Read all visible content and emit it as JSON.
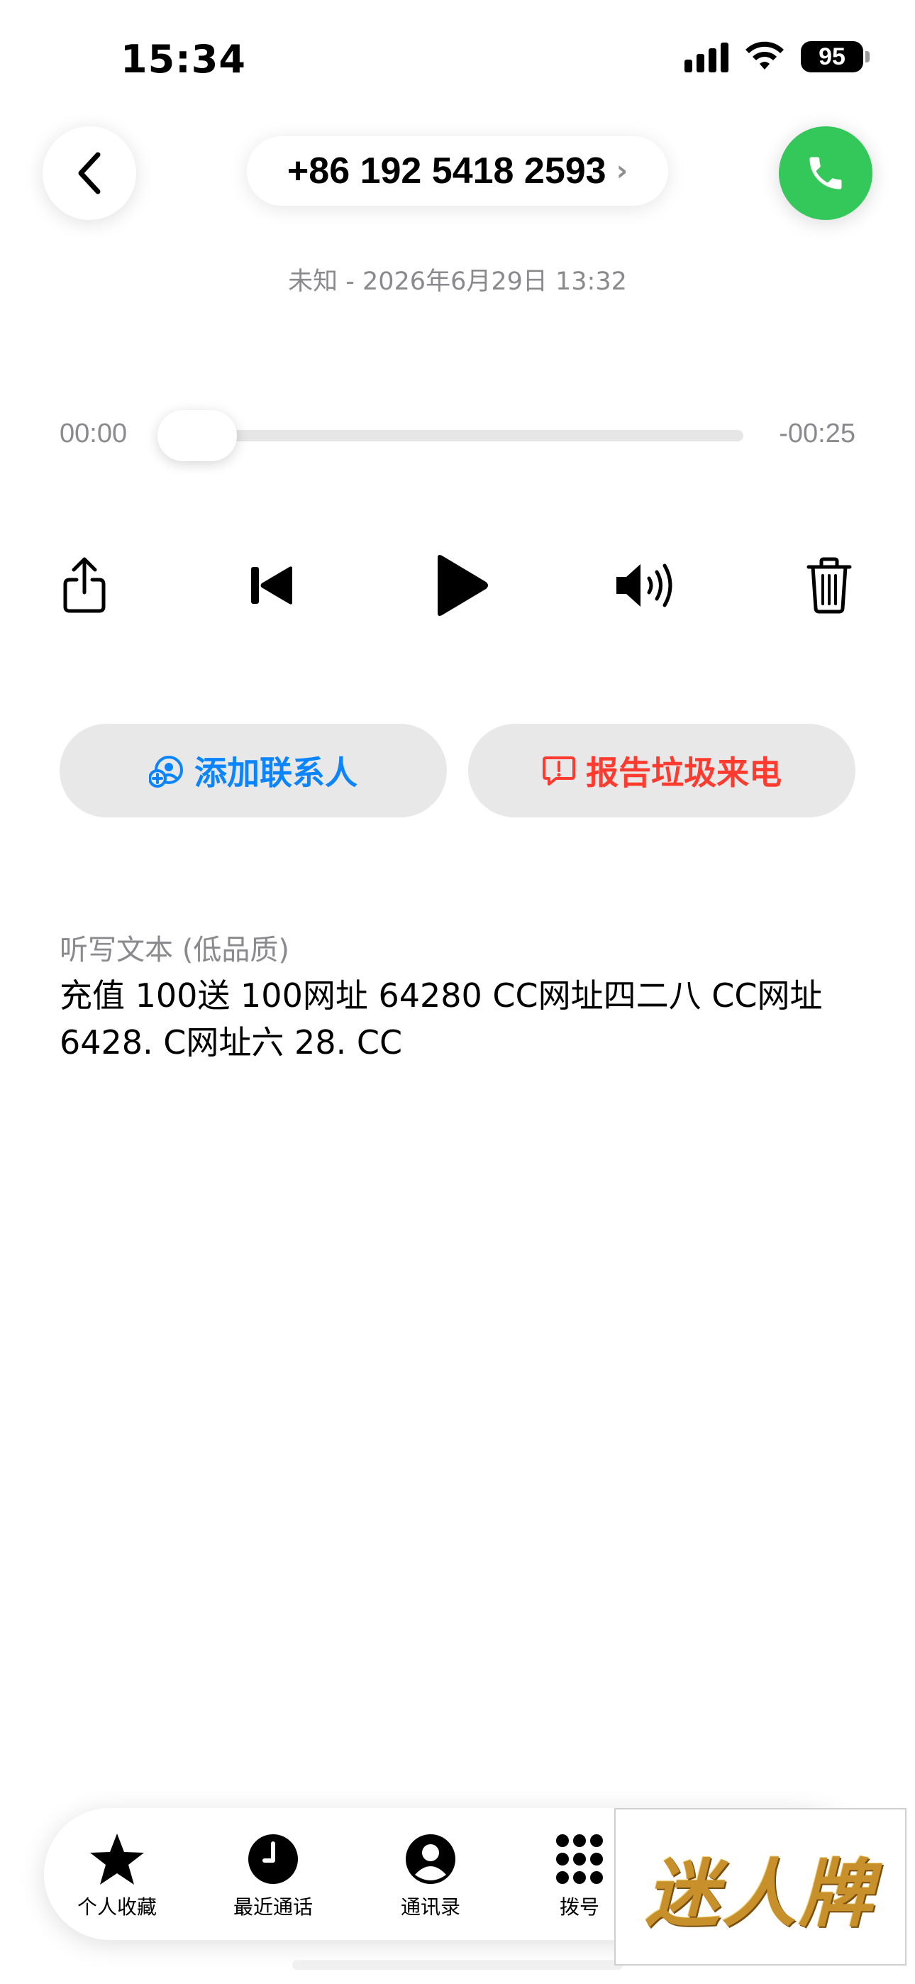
{
  "status_bar": {
    "time": "15:34",
    "battery": "95"
  },
  "header": {
    "phone_number": "+86 192 5418 2593",
    "chevron": "›",
    "subtitle": "未知 - 2026年6月29日 13:32"
  },
  "player": {
    "elapsed": "00:00",
    "remaining": "-00:25",
    "progress": 0
  },
  "controls": {
    "icons": [
      "share-icon",
      "skip-back-icon",
      "play-icon",
      "speaker-icon",
      "trash-icon"
    ]
  },
  "actions": {
    "add_contact": "添加联系人",
    "report_spam": "报告垃圾来电"
  },
  "transcript": {
    "label": "听写文本 (低品质)",
    "text": "充值 100送 100网址 64280 CC网址四二八 CC网址 6428. C网址六 28. CC"
  },
  "tabbar": {
    "favorites": "个人收藏",
    "recents": "最近通话",
    "contacts": "通讯录",
    "keypad": "拨号"
  },
  "watermark": {
    "text": "迷人牌"
  },
  "colors": {
    "call_green": "#34c759",
    "link_blue": "#0a84ff",
    "spam_red": "#ff3b30",
    "secondary_gray": "#8a8a8e"
  }
}
